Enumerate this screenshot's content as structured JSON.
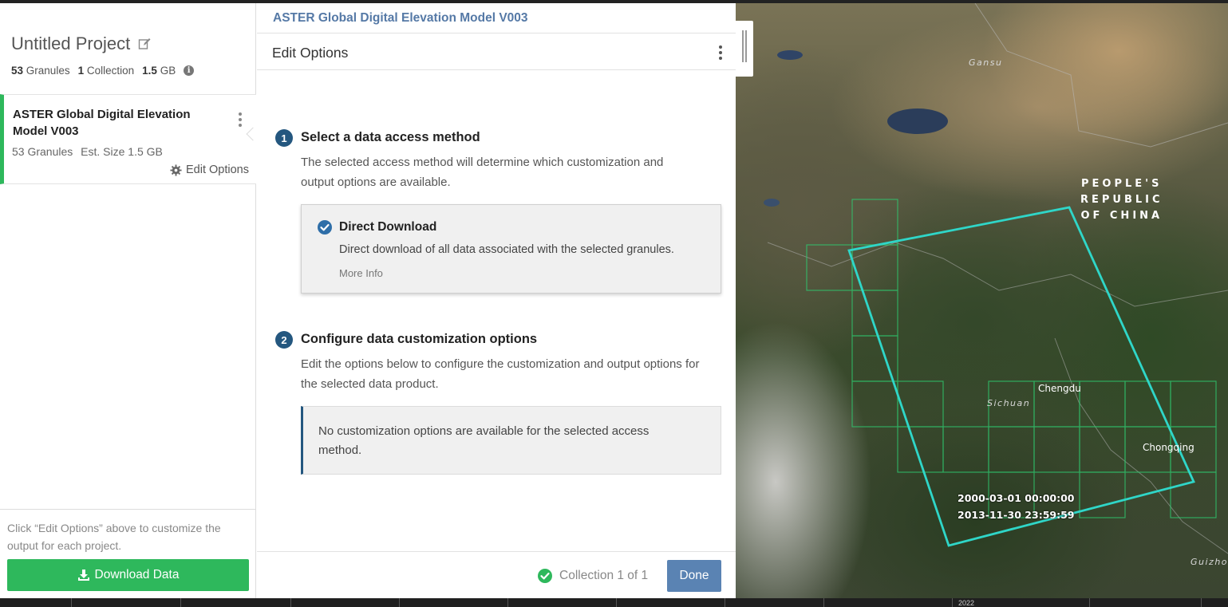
{
  "project": {
    "title": "Untitled Project",
    "granules_count": "53",
    "granules_label": "Granules",
    "collections_count": "1",
    "collections_label": "Collection",
    "size_value": "1.5",
    "size_unit": "GB"
  },
  "collection_card": {
    "title": "ASTER Global Digital Elevation Model V003",
    "granules": "53 Granules",
    "est_size": "Est. Size 1.5 GB",
    "edit_options": "Edit Options"
  },
  "sidebar_footer": {
    "hint": "Click “Edit Options” above to customize the output for each project.",
    "download_label": "Download Data"
  },
  "panel": {
    "header_title": "ASTER Global Digital Elevation Model V003",
    "sub_title": "Edit Options",
    "step1": {
      "number": "1",
      "title": "Select a data access method",
      "description": "The selected access method will determine which customization and output options are available."
    },
    "access_method": {
      "title": "Direct Download",
      "description": "Direct download of all data associated with the selected granules.",
      "more_info": "More Info"
    },
    "step2": {
      "number": "2",
      "title": "Configure data customization options",
      "description": "Edit the options below to configure the customization and output options for the selected data product."
    },
    "notice": "No customization options are available for the selected access method.",
    "footer": {
      "collection_status": "Collection 1 of 1",
      "done_label": "Done"
    }
  },
  "map": {
    "labels": {
      "gansu": "Gansu",
      "country_line1": "PEOPLE'S",
      "country_line2": "REPUBLIC",
      "country_line3": "OF CHINA",
      "chengdu": "Chengdu",
      "sichuan": "Sichuan",
      "chongqing": "Chongqing",
      "guizhou": "Guizho"
    },
    "temporal_start": "2000-03-01 00:00:00",
    "temporal_end": "2013-11-30 23:59:59",
    "spatial_color": "#2fd6c8",
    "granule_color": "#2ecc71"
  },
  "timeline": {
    "year_label": "2022"
  },
  "colors": {
    "accent_green": "#2eb85c",
    "step_blue": "#24577f",
    "done_blue": "#5a83b3",
    "header_link": "#5579a6"
  }
}
